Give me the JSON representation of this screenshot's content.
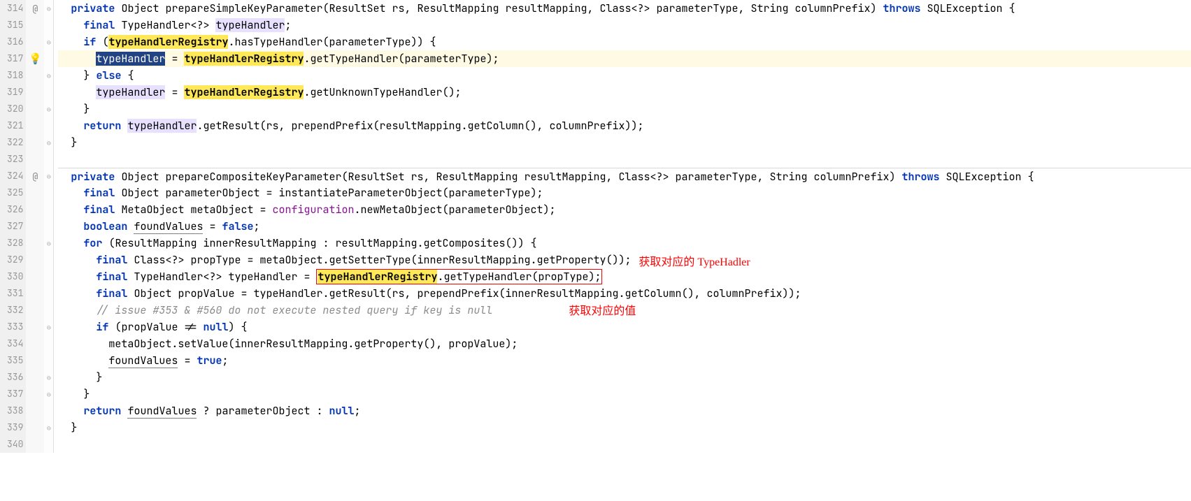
{
  "lines": [
    {
      "num": "314",
      "annot": "@",
      "fold": "⊖"
    },
    {
      "num": "315",
      "fold": ""
    },
    {
      "num": "316",
      "fold": "⊖"
    },
    {
      "num": "317",
      "annot": "bulb",
      "fold": "",
      "current": true
    },
    {
      "num": "318",
      "fold": "⊖"
    },
    {
      "num": "319",
      "fold": ""
    },
    {
      "num": "320",
      "fold": "⊖"
    },
    {
      "num": "321",
      "fold": ""
    },
    {
      "num": "322",
      "fold": "⊖"
    },
    {
      "num": "323",
      "fold": ""
    },
    {
      "num": "324",
      "annot": "@",
      "fold": "⊖",
      "sep": true
    },
    {
      "num": "325",
      "fold": ""
    },
    {
      "num": "326",
      "fold": ""
    },
    {
      "num": "327",
      "fold": ""
    },
    {
      "num": "328",
      "fold": "⊖"
    },
    {
      "num": "329",
      "fold": ""
    },
    {
      "num": "330",
      "fold": ""
    },
    {
      "num": "331",
      "fold": ""
    },
    {
      "num": "332",
      "fold": ""
    },
    {
      "num": "333",
      "fold": "⊖"
    },
    {
      "num": "334",
      "fold": ""
    },
    {
      "num": "335",
      "fold": ""
    },
    {
      "num": "336",
      "fold": "⊖"
    },
    {
      "num": "337",
      "fold": "⊖"
    },
    {
      "num": "338",
      "fold": ""
    },
    {
      "num": "339",
      "fold": "⊖"
    },
    {
      "num": "340",
      "fold": ""
    }
  ],
  "code": {
    "l314": {
      "pre": "  ",
      "kw1": "private",
      "t1": " Object ",
      "m1": "prepareSimpleKeyParameter",
      "t2": "(ResultSet rs, ResultMapping resultMapping, Class<?> parameterType, String columnPrefix) ",
      "kw2": "throws",
      "t3": " SQLException {"
    },
    "l315": {
      "pre": "    ",
      "kw1": "final",
      "t1": " TypeHandler<?> ",
      "hl": "typeHandler",
      "t2": ";"
    },
    "l316": {
      "pre": "    ",
      "kw1": "if",
      "t1": " (",
      "hl": "typeHandlerRegistry",
      "t2": ".hasTypeHandler(parameterType)) {"
    },
    "l317": {
      "pre": "      ",
      "sel": "typeHandler",
      "t1": " = ",
      "hl": "typeHandlerRegistry",
      "t2": ".getTypeHandler(parameterType);"
    },
    "l318": {
      "pre": "    ",
      "t1": "} ",
      "kw1": "else",
      "t2": " {"
    },
    "l319": {
      "pre": "      ",
      "hl1": "typeHandler",
      "t1": " = ",
      "hl2": "typeHandlerRegistry",
      "t2": ".getUnknownTypeHandler();"
    },
    "l320": {
      "pre": "    ",
      "t1": "}"
    },
    "l321": {
      "pre": "    ",
      "kw1": "return",
      "t1": " ",
      "hl": "typeHandler",
      "t2": ".getResult(rs, prependPrefix(resultMapping.getColumn(), columnPrefix));"
    },
    "l322": {
      "pre": "  ",
      "t1": "}"
    },
    "l323": {
      "pre": "",
      "t1": ""
    },
    "l324": {
      "pre": "  ",
      "kw1": "private",
      "t1": " Object ",
      "m1": "prepareCompositeKeyParameter",
      "t2": "(ResultSet rs, ResultMapping resultMapping, Class<?> parameterType, String columnPrefix) ",
      "kw2": "throws",
      "t3": " SQLException {"
    },
    "l325": {
      "pre": "    ",
      "kw1": "final",
      "t1": " Object parameterObject = instantiateParameterObject(parameterType);"
    },
    "l326": {
      "pre": "    ",
      "kw1": "final",
      "t1": " MetaObject metaObject = ",
      "f1": "configuration",
      "t2": ".newMetaObject(parameterObject);"
    },
    "l327": {
      "pre": "    ",
      "kw1": "boolean",
      "t1": " ",
      "u1": "foundValues",
      "t2": " = ",
      "kw2": "false",
      "t3": ";"
    },
    "l328": {
      "pre": "    ",
      "kw1": "for",
      "t1": " (ResultMapping innerResultMapping : resultMapping.getComposites()) {"
    },
    "l329": {
      "pre": "      ",
      "kw1": "final",
      "t1": " Class<?> propType = metaObject.getSetterType(innerResultMapping.getProperty());"
    },
    "l330": {
      "pre": "      ",
      "kw1": "final",
      "t1": " TypeHandler<?> typeHandler = ",
      "rb1": "typeHandlerRegistry",
      "rb2": ".getTypeHandler(propType);"
    },
    "l331": {
      "pre": "      ",
      "kw1": "final",
      "t1": " Object propValue = typeHandler.getResult(rs, prependPrefix(innerResultMapping.getColumn(), columnPrefix));"
    },
    "l332": {
      "pre": "      ",
      "c1": "// issue #353 & #560 do not execute nested query if key is null"
    },
    "l333": {
      "pre": "      ",
      "kw1": "if",
      "t1": " (propValue != ",
      "kw2": "null",
      "t2": ") {"
    },
    "l334": {
      "pre": "        ",
      "t1": "metaObject.setValue(innerResultMapping.getProperty(), propValue);"
    },
    "l335": {
      "pre": "        ",
      "u1": "foundValues",
      "t1": " = ",
      "kw1": "true",
      "t2": ";"
    },
    "l336": {
      "pre": "      ",
      "t1": "}"
    },
    "l337": {
      "pre": "    ",
      "t1": "}"
    },
    "l338": {
      "pre": "    ",
      "kw1": "return",
      "t1": " ",
      "u1": "foundValues",
      "t2": " ? parameterObject : ",
      "kw2": "null",
      "t3": ";"
    },
    "l339": {
      "pre": "  ",
      "t1": "}"
    },
    "l340": {
      "pre": "",
      "t1": ""
    }
  },
  "annotations": {
    "a1": "获取对应的 TypeHadler",
    "a2": "获取对应的值"
  }
}
